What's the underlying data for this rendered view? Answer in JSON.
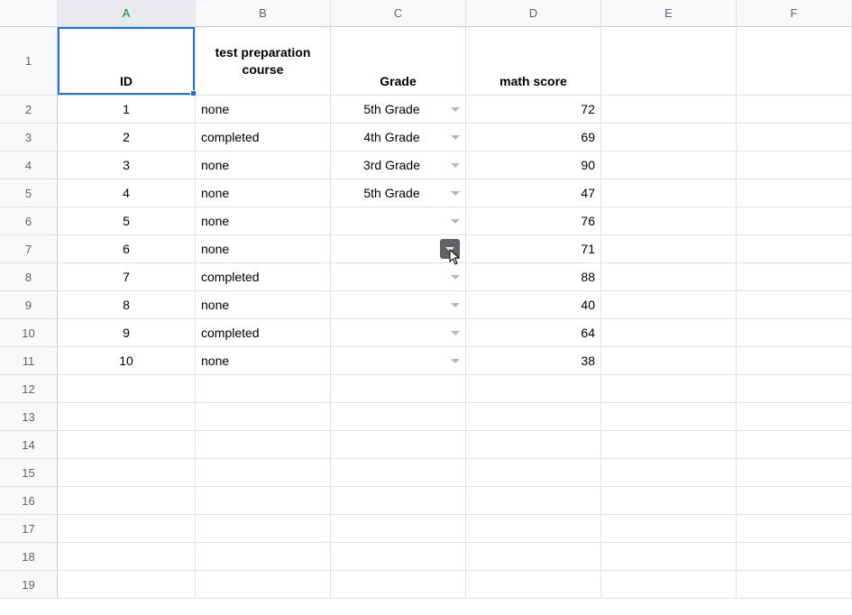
{
  "columns": [
    "A",
    "B",
    "C",
    "D",
    "E",
    "F"
  ],
  "row_count": 19,
  "selected_cell": "A1",
  "headers": {
    "A": "ID",
    "B": "test preparation course",
    "C": "Grade",
    "D": "math score"
  },
  "rows": [
    {
      "id": "1",
      "prep": "none",
      "grade": "5th Grade",
      "math": "72"
    },
    {
      "id": "2",
      "prep": "completed",
      "grade": "4th Grade",
      "math": "69"
    },
    {
      "id": "3",
      "prep": "none",
      "grade": "3rd Grade",
      "math": "90"
    },
    {
      "id": "4",
      "prep": "none",
      "grade": "5th Grade",
      "math": "47"
    },
    {
      "id": "5",
      "prep": "none",
      "grade": "",
      "math": "76"
    },
    {
      "id": "6",
      "prep": "none",
      "grade": "",
      "math": "71"
    },
    {
      "id": "7",
      "prep": "completed",
      "grade": "",
      "math": "88"
    },
    {
      "id": "8",
      "prep": "none",
      "grade": "",
      "math": "40"
    },
    {
      "id": "9",
      "prep": "completed",
      "grade": "",
      "math": "64"
    },
    {
      "id": "10",
      "prep": "none",
      "grade": "",
      "math": "38"
    }
  ]
}
